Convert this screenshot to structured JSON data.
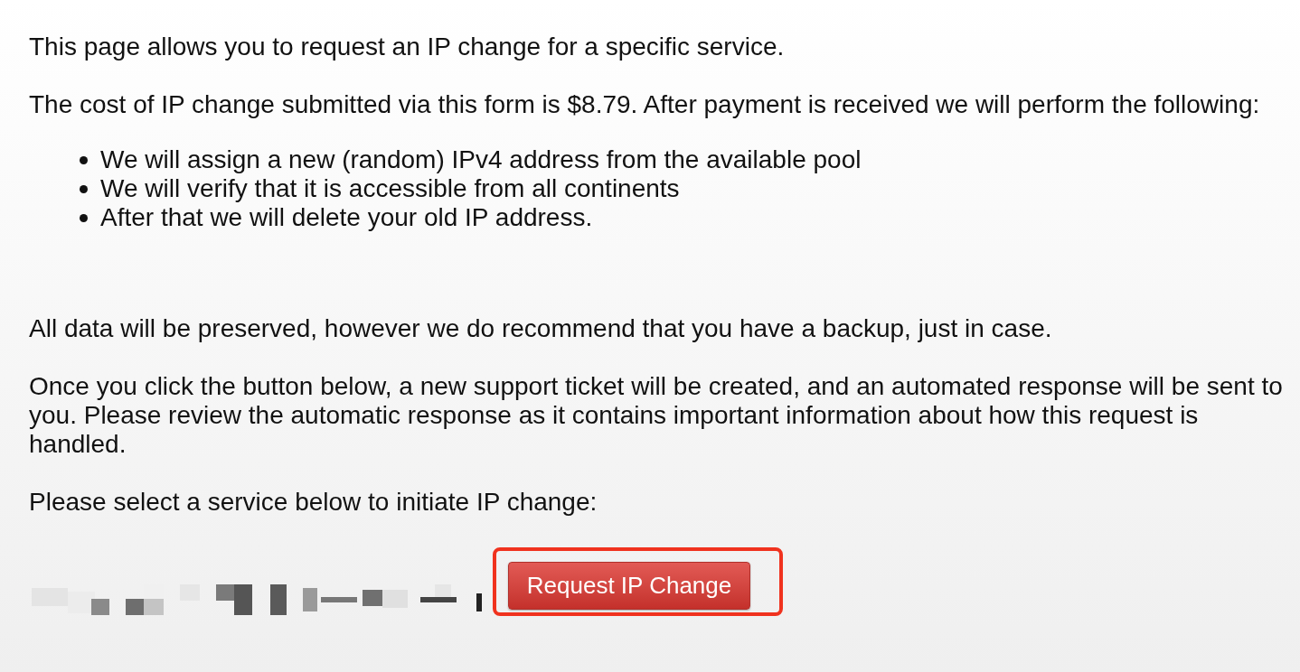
{
  "intro": "This page allows you to request an IP change for a specific service.",
  "cost_note": "The cost of IP change submitted via this form is $8.79. After payment is received we will perform the following:",
  "steps": [
    "We will assign a new (random) IPv4 address from the available pool",
    "We will verify that it is accessible from all continents",
    "After that we will delete your old IP address."
  ],
  "backup_note": "All data will be preserved, however we do recommend that you have a backup, just in case.",
  "ticket_note": "Once you click the button below, a new support ticket will be created, and an automated response will be sent to you. Please review the automatic response as it contains important information about how this request is handled.",
  "select_prompt": "Please select a service below to initiate IP change:",
  "service": {
    "label_redacted": true,
    "button": {
      "label": "Request IP Change",
      "highlighted": true
    }
  }
}
